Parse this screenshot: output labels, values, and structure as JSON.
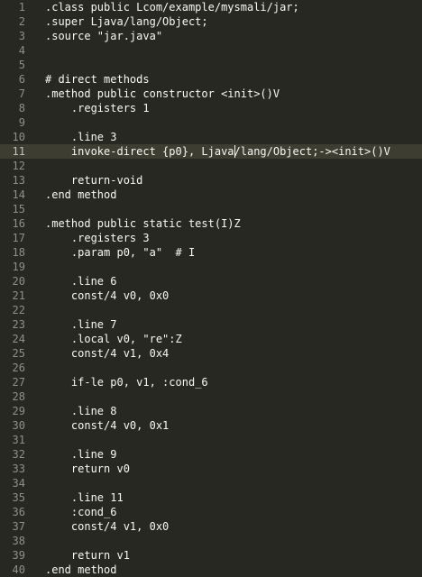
{
  "editor": {
    "active_line": 11,
    "lines": [
      {
        "num": "1",
        "text": ".class public Lcom/example/mysmali/jar;"
      },
      {
        "num": "2",
        "text": ".super Ljava/lang/Object;"
      },
      {
        "num": "3",
        "text": ".source \"jar.java\""
      },
      {
        "num": "4",
        "text": ""
      },
      {
        "num": "5",
        "text": ""
      },
      {
        "num": "6",
        "text": "# direct methods"
      },
      {
        "num": "7",
        "text": ".method public constructor <init>()V"
      },
      {
        "num": "8",
        "text": "    .registers 1"
      },
      {
        "num": "9",
        "text": ""
      },
      {
        "num": "10",
        "text": "    .line 3"
      },
      {
        "num": "11",
        "text": "    invoke-direct {p0}, Ljava/lang/Object;-><init>()V"
      },
      {
        "num": "12",
        "text": ""
      },
      {
        "num": "13",
        "text": "    return-void"
      },
      {
        "num": "14",
        "text": ".end method"
      },
      {
        "num": "15",
        "text": ""
      },
      {
        "num": "16",
        "text": ".method public static test(I)Z"
      },
      {
        "num": "17",
        "text": "    .registers 3"
      },
      {
        "num": "18",
        "text": "    .param p0, \"a\"  # I"
      },
      {
        "num": "19",
        "text": ""
      },
      {
        "num": "20",
        "text": "    .line 6"
      },
      {
        "num": "21",
        "text": "    const/4 v0, 0x0"
      },
      {
        "num": "22",
        "text": ""
      },
      {
        "num": "23",
        "text": "    .line 7"
      },
      {
        "num": "24",
        "text": "    .local v0, \"re\":Z"
      },
      {
        "num": "25",
        "text": "    const/4 v1, 0x4"
      },
      {
        "num": "26",
        "text": ""
      },
      {
        "num": "27",
        "text": "    if-le p0, v1, :cond_6"
      },
      {
        "num": "28",
        "text": ""
      },
      {
        "num": "29",
        "text": "    .line 8"
      },
      {
        "num": "30",
        "text": "    const/4 v0, 0x1"
      },
      {
        "num": "31",
        "text": ""
      },
      {
        "num": "32",
        "text": "    .line 9"
      },
      {
        "num": "33",
        "text": "    return v0"
      },
      {
        "num": "34",
        "text": ""
      },
      {
        "num": "35",
        "text": "    .line 11"
      },
      {
        "num": "36",
        "text": "    :cond_6"
      },
      {
        "num": "37",
        "text": "    const/4 v1, 0x0"
      },
      {
        "num": "38",
        "text": ""
      },
      {
        "num": "39",
        "text": "    return v1"
      },
      {
        "num": "40",
        "text": ".end method"
      }
    ],
    "caret": {
      "line": 11,
      "column": 29
    }
  }
}
